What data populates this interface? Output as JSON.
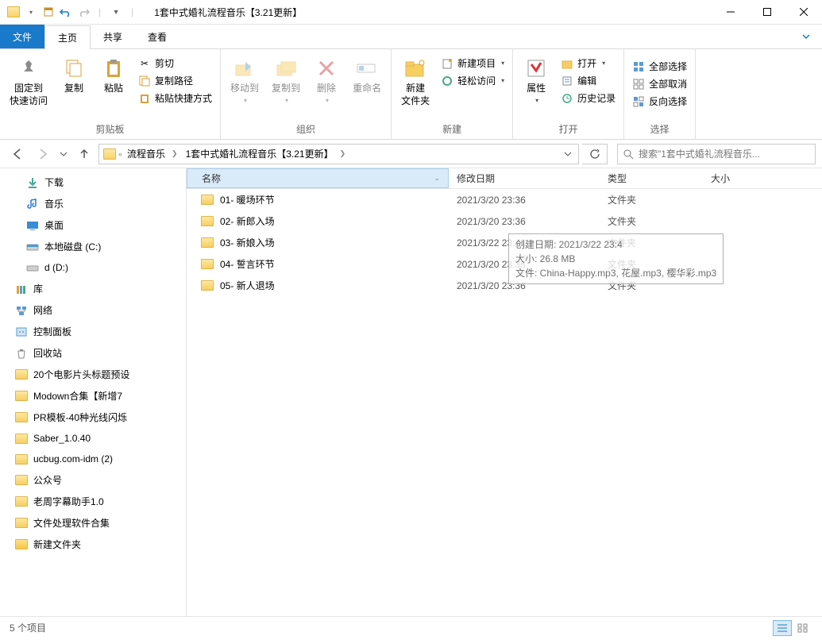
{
  "title": "1套中式婚礼流程音乐【3.21更新】",
  "title_sep": "|",
  "tabs": {
    "file": "文件",
    "home": "主页",
    "share": "共享",
    "view": "查看"
  },
  "ribbon": {
    "clipboard": {
      "pin": "固定到\n快速访问",
      "copy": "复制",
      "paste": "粘贴",
      "cut": "剪切",
      "copypath": "复制路径",
      "pasteshortcut": "粘贴快捷方式",
      "label": "剪贴板"
    },
    "organize": {
      "moveto": "移动到",
      "copyto": "复制到",
      "delete": "删除",
      "rename": "重命名",
      "label": "组织"
    },
    "new": {
      "newfolder": "新建\n文件夹",
      "newitem": "新建项目",
      "easyaccess": "轻松访问",
      "label": "新建"
    },
    "open": {
      "properties": "属性",
      "open": "打开",
      "edit": "编辑",
      "history": "历史记录",
      "label": "打开"
    },
    "select": {
      "selectall": "全部选择",
      "selectnone": "全部取消",
      "invert": "反向选择",
      "label": "选择"
    }
  },
  "breadcrumb": {
    "a": "流程音乐",
    "b": "1套中式婚礼流程音乐【3.21更新】",
    "sep": "«"
  },
  "search": {
    "placeholder": "搜索\"1套中式婚礼流程音乐..."
  },
  "tree": {
    "items": [
      {
        "label": "下载",
        "kind": "download",
        "lvl": 1
      },
      {
        "label": "音乐",
        "kind": "music",
        "lvl": 1
      },
      {
        "label": "桌面",
        "kind": "desktop",
        "lvl": 1
      },
      {
        "label": "本地磁盘 (C:)",
        "kind": "drive",
        "lvl": 1
      },
      {
        "label": "d (D:)",
        "kind": "drive2",
        "lvl": 1
      },
      {
        "label": "库",
        "kind": "libraries",
        "lvl": 0
      },
      {
        "label": "网络",
        "kind": "network",
        "lvl": 0
      },
      {
        "label": "控制面板",
        "kind": "controlpanel",
        "lvl": 0
      },
      {
        "label": "回收站",
        "kind": "recycle",
        "lvl": 0
      },
      {
        "label": "20个电影片头标题预设",
        "kind": "folder",
        "lvl": 0
      },
      {
        "label": "Modown合集【新增7",
        "kind": "folder",
        "lvl": 0
      },
      {
        "label": "PR模板-40种光线闪烁",
        "kind": "folder",
        "lvl": 0
      },
      {
        "label": "Saber_1.0.40",
        "kind": "folder",
        "lvl": 0
      },
      {
        "label": "ucbug.com-idm (2)",
        "kind": "folder",
        "lvl": 0
      },
      {
        "label": "公众号",
        "kind": "folder",
        "lvl": 0
      },
      {
        "label": "老周字幕助手1.0",
        "kind": "folder",
        "lvl": 0
      },
      {
        "label": "文件处理软件合集",
        "kind": "folder",
        "lvl": 0
      },
      {
        "label": "新建文件夹",
        "kind": "folder-sel",
        "lvl": 0
      }
    ]
  },
  "columns": {
    "name": "名称",
    "date": "修改日期",
    "type": "类型",
    "size": "大小"
  },
  "files": [
    {
      "name": "01- 暖场环节",
      "date": "2021/3/20 23:36",
      "type": "文件夹"
    },
    {
      "name": "02- 新郎入场",
      "date": "2021/3/20 23:36",
      "type": "文件夹"
    },
    {
      "name": "03- 新娘入场",
      "date": "2021/3/22 23:41",
      "type": "文件夹"
    },
    {
      "name": "04- 誓言环节",
      "date": "2021/3/20 23:36",
      "type": "文件夹"
    },
    {
      "name": "05- 新人退场",
      "date": "2021/3/20 23:36",
      "type": "文件夹"
    }
  ],
  "tooltip": {
    "l1": "创建日期: 2021/3/22 23:4",
    "l2": "大小: 26.8 MB",
    "l3": "文件: China-Happy.mp3, 花屋.mp3, 樱华彩.mp3"
  },
  "status": "5 个项目"
}
